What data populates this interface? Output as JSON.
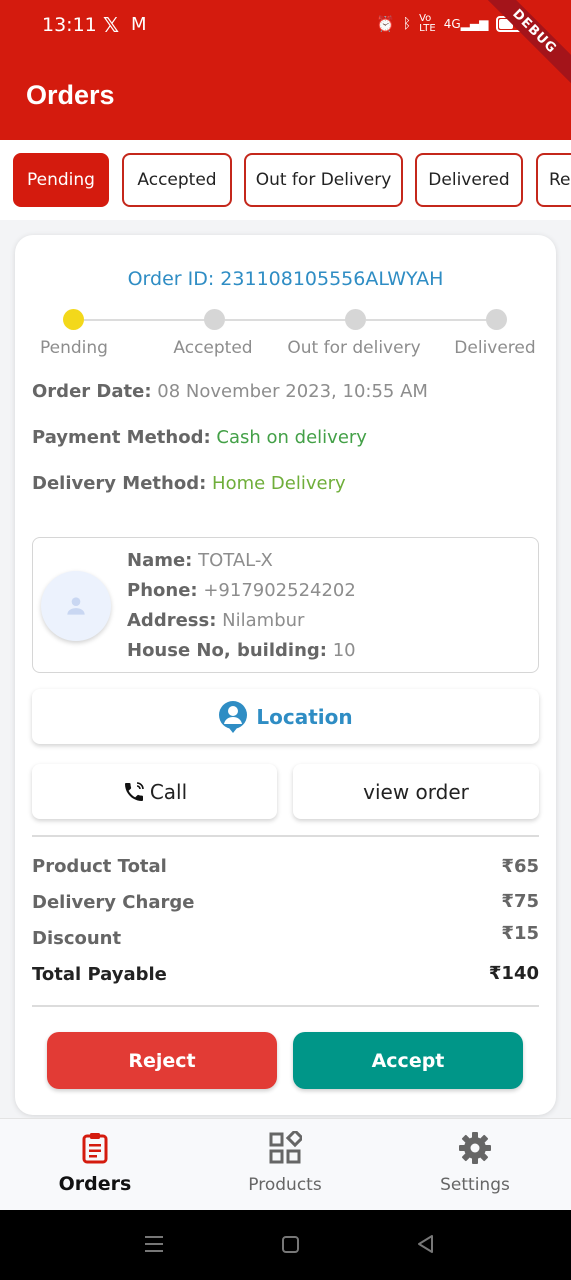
{
  "status_bar": {
    "time": "13:11",
    "icons": [
      "x-icon",
      "gmail-icon",
      "alarm-icon",
      "bluetooth-icon",
      "volte-icon",
      "signal-icon",
      "battery-icon"
    ],
    "debug_banner": "DEBUG"
  },
  "header": {
    "title": "Orders"
  },
  "tabs": [
    {
      "label": "Pending",
      "active": true
    },
    {
      "label": "Accepted",
      "active": false
    },
    {
      "label": "Out for Delivery",
      "active": false
    },
    {
      "label": "Delivered",
      "active": false
    },
    {
      "label": "Re",
      "active": false
    }
  ],
  "order": {
    "id_line": "Order ID: 231108105556ALWYAH",
    "steps": [
      "Pending",
      "Accepted",
      "Out for delivery",
      "Delivered"
    ],
    "current_step": 0,
    "order_date_label": "Order Date:",
    "order_date": "08 November 2023, 10:55 AM",
    "payment_method_label": "Payment Method:",
    "payment_method": "Cash on delivery",
    "delivery_method_label": "Delivery Method:",
    "delivery_method": "Home Delivery"
  },
  "customer": {
    "name_label": "Name:",
    "name": "TOTAL-X",
    "phone_label": "Phone:",
    "phone": "+917902524202",
    "address_label": "Address:",
    "address": "Nilambur",
    "house_label": "House No, building:",
    "house": "10"
  },
  "actions": {
    "location_label": "Location",
    "call_label": "Call",
    "view_order_label": "view order"
  },
  "summary": {
    "product_total_label": "Product Total",
    "product_total": "₹65",
    "delivery_charge_label": "Delivery Charge",
    "delivery_charge": "₹75",
    "discount_label": "Discount",
    "discount": "₹15",
    "total_payable_label": "Total Payable",
    "total_payable": "₹140"
  },
  "buttons": {
    "reject_label": "Reject",
    "accept_label": "Accept"
  },
  "bottom_nav": [
    {
      "label": "Orders",
      "icon": "clipboard-icon",
      "active": true
    },
    {
      "label": "Products",
      "icon": "categories-icon",
      "active": false
    },
    {
      "label": "Settings",
      "icon": "gear-icon",
      "active": false
    }
  ],
  "colors": {
    "brand_red": "#d41b0e",
    "accept_teal": "#009688",
    "reject_red": "#e23b35",
    "link_blue": "#2f8dc4",
    "pending_yellow": "#f3d81b"
  }
}
